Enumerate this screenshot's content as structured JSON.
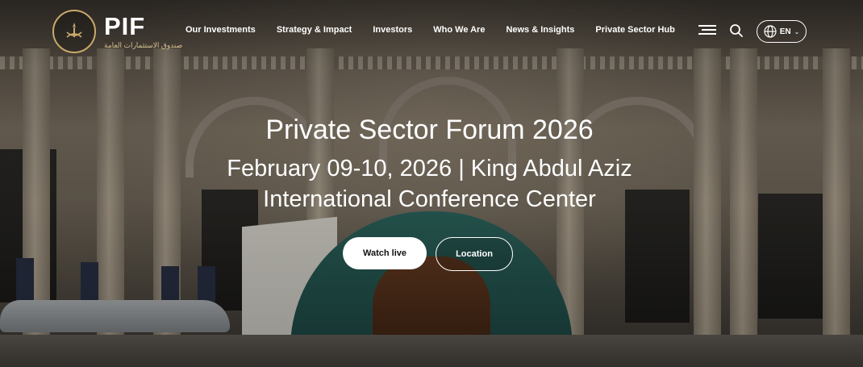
{
  "header": {
    "logo": {
      "name": "PIF",
      "arabic_subtitle": "صندوق الاستثمارات العامة"
    },
    "nav": [
      {
        "label": "Our Investments"
      },
      {
        "label": "Strategy & Impact"
      },
      {
        "label": "Investors"
      },
      {
        "label": "Who We Are"
      },
      {
        "label": "News & Insights"
      },
      {
        "label": "Private Sector Hub"
      }
    ],
    "menu_icon": "hamburger-icon",
    "search_icon": "search-icon",
    "language": {
      "label": "EN",
      "icon": "globe-icon"
    }
  },
  "hero": {
    "title": "Private Sector Forum 2026",
    "subtitle_line1": "February 09-10, 2026 | King Abdul Aziz",
    "subtitle_line2": "International Conference Center",
    "buttons": {
      "primary": "Watch live",
      "secondary": "Location"
    }
  },
  "colors": {
    "gold_accent": "#c8a96a",
    "primary_button_bg": "#ffffff",
    "primary_button_text": "#111111"
  }
}
